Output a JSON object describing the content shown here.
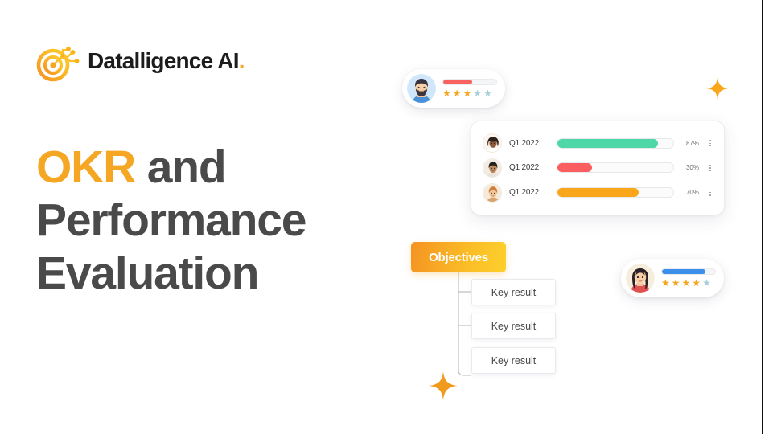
{
  "brand": {
    "name": "Datalligence AI",
    "name_main": "Datalligence AI",
    "trailing_dot": ".",
    "logo_icon": "bullseye-circuit-icon",
    "accent": "#F5A623",
    "text_color": "#1c1c1c"
  },
  "headline": {
    "highlight": "OKR",
    "rest_line1": " and",
    "line2": "Performance",
    "line3": "Evaluation",
    "highlight_color": "#F5A623",
    "body_color": "#4a4a4a"
  },
  "review_cards": [
    {
      "id": "male",
      "avatar": "bearded-man-avatar",
      "avatar_bg": "#cfe6fb",
      "bar_color": "#FA6262",
      "bar_percent": 55,
      "stars_filled": 3,
      "stars_total": 5
    },
    {
      "id": "female",
      "avatar": "long-hair-woman-avatar",
      "avatar_bg": "#f6eddc",
      "bar_color": "#3B8FE8",
      "bar_percent": 82,
      "stars_filled": 4,
      "stars_total": 5
    }
  ],
  "progress_card": {
    "menu_icon": "kebab-menu-icon",
    "rows": [
      {
        "avatar": "curly-hair-woman-avatar",
        "label": "Q1 2022",
        "percent": 87,
        "percent_label": "87%",
        "color": "#4ED8A8"
      },
      {
        "avatar": "dark-hair-man-avatar",
        "label": "Q1 2022",
        "percent": 30,
        "percent_label": "30%",
        "color": "#FA5E5E"
      },
      {
        "avatar": "red-hair-man-avatar",
        "label": "Q1 2022",
        "percent": 70,
        "percent_label": "70%",
        "color": "#FAA61A"
      }
    ]
  },
  "tree": {
    "root_label": "Objectives",
    "root_gradient_from": "#F59323",
    "root_gradient_to": "#FDD02C",
    "children": [
      {
        "label": "Key result"
      },
      {
        "label": "Key result"
      },
      {
        "label": "Key result"
      }
    ]
  },
  "decorations": [
    {
      "name": "sparkle-top-right",
      "color": "#F9A61B"
    },
    {
      "name": "sparkle-bottom-left",
      "color": "#F09B1E"
    }
  ]
}
